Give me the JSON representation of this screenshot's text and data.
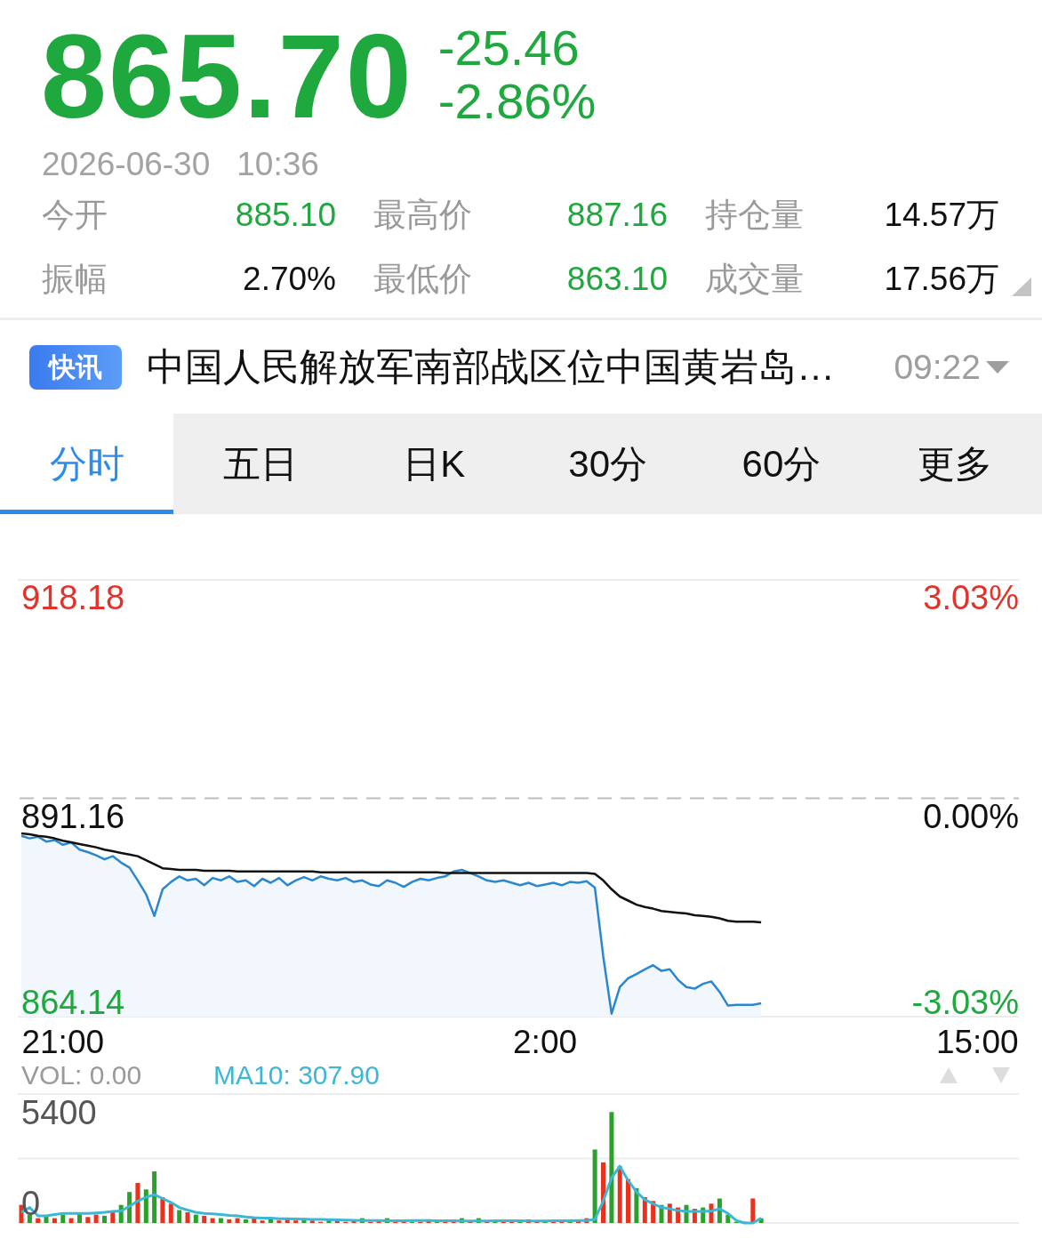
{
  "quote": {
    "price": "865.70",
    "change": "-25.46",
    "change_pct": "-2.86%",
    "date": "2026-06-30",
    "time": "10:36"
  },
  "stats": [
    {
      "label": "今开",
      "value": "885.10",
      "color": "#1fa83e"
    },
    {
      "label": "最高价",
      "value": "887.16",
      "color": "#1fa83e"
    },
    {
      "label": "持仓量",
      "value": "14.57万",
      "color": "#111111"
    },
    {
      "label": "振幅",
      "value": "2.70%",
      "color": "#111111"
    },
    {
      "label": "最低价",
      "value": "863.10",
      "color": "#1fa83e"
    },
    {
      "label": "成交量",
      "value": "17.56万",
      "color": "#111111"
    }
  ],
  "news": {
    "badge": "快讯",
    "headline": "中国人民解放军南部战区位中国黄岩岛…",
    "time": "09:22"
  },
  "tabs": [
    {
      "label": "分时",
      "selected": true
    },
    {
      "label": "五日",
      "selected": false
    },
    {
      "label": "日K",
      "selected": false
    },
    {
      "label": "30分",
      "selected": false
    },
    {
      "label": "60分",
      "selected": false
    },
    {
      "label": "更多",
      "selected": false
    }
  ],
  "price_chart": {
    "right_labels": [
      {
        "text": "3.03%",
        "color": "#e2332b"
      },
      {
        "text": "0.00%",
        "color": "#111111"
      },
      {
        "text": "-3.03%",
        "color": "#1fa83e"
      }
    ],
    "chart_data": {
      "type": "line",
      "categories": [
        null,
        null,
        null,
        null,
        null,
        "21:00",
        null,
        null,
        null,
        null,
        null,
        null,
        null,
        null,
        null,
        null,
        null,
        null,
        null,
        null,
        null,
        null,
        null,
        null,
        null,
        null,
        null,
        null,
        null,
        null,
        null,
        null,
        null,
        null,
        null,
        null,
        null,
        null,
        null,
        null,
        null,
        null,
        null,
        null,
        null,
        null,
        null,
        null,
        null,
        null,
        null,
        null,
        null,
        null,
        null,
        null,
        null,
        null,
        null,
        null,
        null,
        null,
        null,
        "2:00",
        null,
        null,
        null,
        null,
        null,
        null,
        null,
        null,
        null,
        null,
        null,
        null,
        null,
        null,
        null,
        null,
        null,
        null,
        null,
        null,
        null,
        null,
        null,
        null,
        null,
        null,
        null,
        null,
        null,
        null,
        null,
        null,
        null,
        null,
        null,
        null,
        null,
        null,
        null,
        null,
        null,
        null,
        null,
        null,
        null,
        null,
        null,
        null,
        null,
        null,
        null,
        "15:00",
        null,
        null,
        null,
        null,
        null
      ],
      "ylim": [
        864.14,
        918.18
      ],
      "yticks": [
        {
          "value": 864.14,
          "label": "864.14"
        },
        {
          "value": 891.16,
          "label": "891.16"
        },
        {
          "value": 918.18,
          "label": "918.18"
        }
      ],
      "series": [
        {
          "color": "#2b87cf",
          "values": [
            886.5,
            886.2,
            886.4,
            885.8,
            886.0,
            885.4,
            885.7,
            884.8,
            884.5,
            884.1,
            883.6,
            884.0,
            883.2,
            882.6,
            881.0,
            879.3,
            876.6,
            879.9,
            880.8,
            881.5,
            881.0,
            881.2,
            880.4,
            881.3,
            881.0,
            881.5,
            880.8,
            881.0,
            880.3,
            881.2,
            880.7,
            881.3,
            880.4,
            881.0,
            881.4,
            881.0,
            881.5,
            881.2,
            881.0,
            881.3,
            880.8,
            881.0,
            880.5,
            880.3,
            881.0,
            880.7,
            880.2,
            880.8,
            881.2,
            881.0,
            881.3,
            881.5,
            882.1,
            882.3,
            881.9,
            881.5,
            881.0,
            880.8,
            881.0,
            880.7,
            880.4,
            880.7,
            880.3,
            880.5,
            880.7,
            880.4,
            880.8,
            880.7,
            880.9,
            880.1,
            871.6,
            864.5,
            867.8,
            868.9,
            869.4,
            870.0,
            870.5,
            869.8,
            870.0,
            868.7,
            867.8,
            867.6,
            868.2,
            868.5,
            867.2,
            865.5,
            865.6,
            865.6,
            865.6,
            865.8,
            null,
            null,
            null,
            null,
            null,
            null,
            null,
            null,
            null,
            null,
            null,
            null,
            null,
            null,
            null,
            null,
            null,
            null,
            null,
            null,
            null,
            null,
            null,
            null,
            null,
            null,
            null,
            null,
            null,
            null,
            null
          ]
        },
        {
          "color": "#111111",
          "values": [
            886.8,
            886.7,
            886.5,
            886.4,
            886.2,
            885.9,
            885.7,
            885.5,
            885.3,
            885.1,
            884.8,
            884.6,
            884.4,
            884.2,
            884.0,
            883.5,
            883.0,
            882.5,
            882.4,
            882.3,
            882.3,
            882.3,
            882.2,
            882.2,
            882.2,
            882.2,
            882.1,
            882.1,
            882.1,
            882.1,
            882.1,
            882.1,
            882.1,
            882.1,
            882.1,
            882.1,
            882.0,
            882.0,
            882.0,
            882.0,
            882.0,
            882.0,
            882.0,
            882.0,
            882.0,
            882.0,
            882.0,
            882.0,
            882.0,
            882.0,
            882.0,
            881.9,
            881.9,
            881.9,
            881.9,
            881.9,
            881.9,
            881.9,
            881.9,
            881.9,
            881.9,
            881.9,
            881.9,
            881.9,
            881.9,
            881.9,
            881.9,
            881.9,
            881.9,
            881.8,
            881.0,
            879.9,
            879.0,
            878.5,
            878.0,
            877.7,
            877.5,
            877.2,
            877.1,
            877.0,
            876.9,
            876.7,
            876.6,
            876.5,
            876.3,
            876.0,
            875.9,
            875.9,
            875.9,
            875.8,
            null,
            null,
            null,
            null,
            null,
            null,
            null,
            null,
            null,
            null,
            null,
            null,
            null,
            null,
            null,
            null,
            null,
            null,
            null,
            null,
            null,
            null,
            null,
            null,
            null,
            null,
            null,
            null,
            null,
            null,
            null
          ]
        }
      ]
    }
  },
  "volume_panel": {
    "vol_label": "VOL: 0.00",
    "ma_label": "MA10: 307.90",
    "axis_labels": [
      "5400",
      "0"
    ]
  }
}
